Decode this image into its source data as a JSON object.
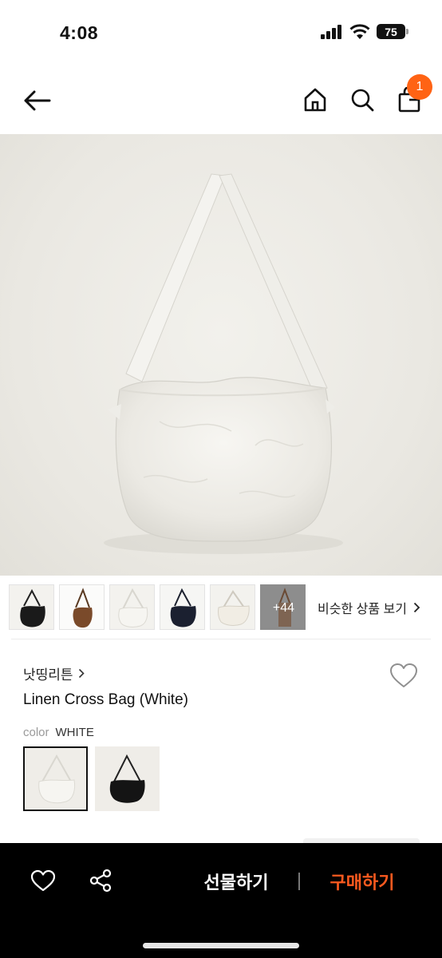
{
  "status_bar": {
    "time": "4:08",
    "battery": "75"
  },
  "nav": {
    "cart_count": "1",
    "icons": [
      "back-arrow-icon",
      "home-icon",
      "search-icon",
      "shopping-bag-icon"
    ]
  },
  "thumbnails": {
    "more_label": "+44",
    "similar_label": "비슷한 상품 보기"
  },
  "product": {
    "brand": "낫띵리튼",
    "name": "Linen Cross Bag (White)",
    "color_key": "color",
    "color_value": "WHITE"
  },
  "actions": {
    "gift_label": "선물하기",
    "buy_label": "구매하기"
  },
  "colors": {
    "accent": "#ff6314",
    "buy": "#ff5a1f",
    "action_bar_bg": "#000000"
  }
}
